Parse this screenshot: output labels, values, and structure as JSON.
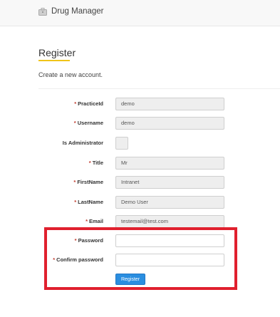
{
  "navbar": {
    "brand": "Drug Manager",
    "brand_icon": "briefcase-icon"
  },
  "page": {
    "title": "Register",
    "subtitle": "Create a new account.",
    "accent_color": "#f0c419"
  },
  "form": {
    "required_marker": "*",
    "fields": [
      {
        "label": "PracticeId",
        "value": "demo",
        "required": true
      },
      {
        "label": "Username",
        "value": "demo",
        "required": true
      },
      {
        "label": "Is Administrator",
        "value": "",
        "required": false
      },
      {
        "label": "Title",
        "value": "Mr",
        "required": true
      },
      {
        "label": "FirstName",
        "value": "Intranet",
        "required": true
      },
      {
        "label": "LastName",
        "value": "Demo User",
        "required": true
      },
      {
        "label": "Email",
        "value": "testemail@test.com",
        "required": true
      },
      {
        "label": "Password",
        "value": "",
        "required": true
      },
      {
        "label": "Confirm password",
        "value": "",
        "required": true
      }
    ],
    "submit_label": "Register",
    "highlight_color": "#e0202e"
  }
}
